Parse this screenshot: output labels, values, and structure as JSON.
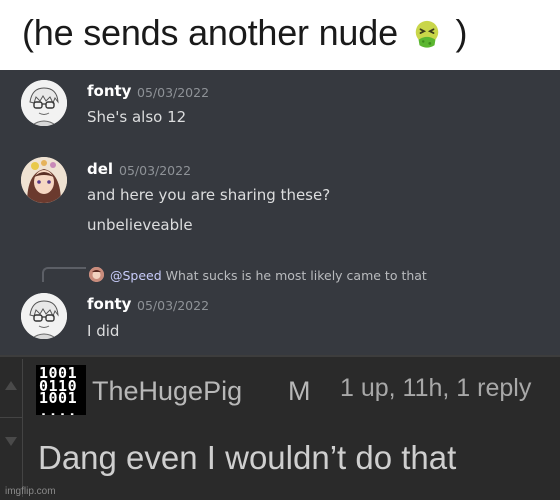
{
  "caption": {
    "text_before": "(he sends another nude",
    "emoji_icon": "nauseated-face-icon",
    "text_after": ")"
  },
  "chat": {
    "background": "#36393f",
    "messages": [
      {
        "username": "fonty",
        "timestamp": "05/03/2022",
        "avatar_icon": "anime-boy-with-glasses-avatar",
        "lines": [
          "She's also 12"
        ]
      },
      {
        "username": "del",
        "timestamp": "05/03/2022",
        "avatar_icon": "anime-girl-avatar",
        "lines": [
          "and here you are sharing these?",
          "unbelieveable"
        ]
      },
      {
        "reply": {
          "mention": "@Speed",
          "text": "What sucks is he most likely came to that"
        },
        "username": "fonty",
        "timestamp": "05/03/2022",
        "avatar_icon": "anime-boy-with-glasses-avatar",
        "lines": [
          "I did"
        ]
      }
    ]
  },
  "comment": {
    "username": "TheHugePig",
    "badge": "M",
    "meta": "1 up, 11h, 1 reply",
    "text": "Dang even I wouldn’t do that",
    "user_icon": "binary-code-icon",
    "user_icon_text": "1001\n0110\n1001\n...."
  },
  "watermark": "imgflip.com"
}
